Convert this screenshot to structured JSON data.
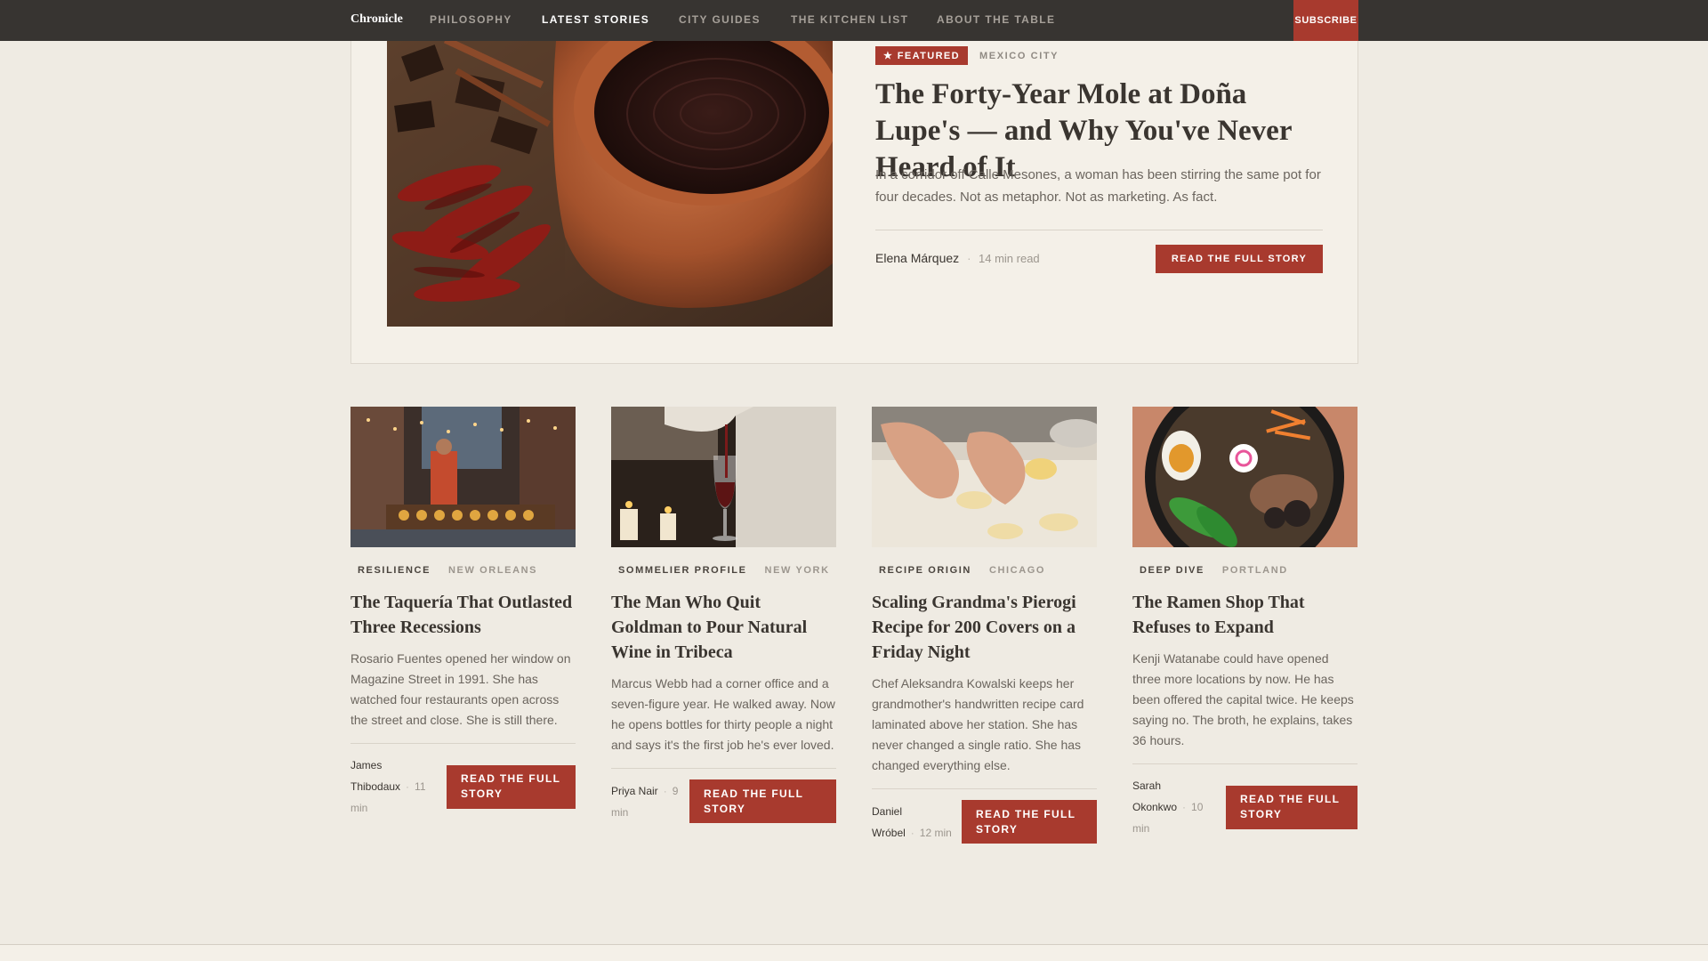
{
  "nav": {
    "brand": "Chronicle",
    "links": [
      "PHILOSOPHY",
      "LATEST STORIES",
      "CITY GUIDES",
      "THE KITCHEN LIST",
      "ABOUT THE TABLE"
    ],
    "active": "LATEST STORIES",
    "subscribe": "SUBSCRIBE"
  },
  "featured": {
    "badge": "★ FEATURED",
    "city": "MEXICO CITY",
    "title": "The Forty-Year Mole at Doña Lupe's — and Why You've Never Heard of It",
    "dek": "In a corridor off Calle Mesones, a woman has been stirring the same pot for four decades. Not as metaphor. Not as marketing. As fact.",
    "author": "Elena Márquez",
    "separator": "·",
    "read_time": "14 min read",
    "cta": "READ THE FULL STORY"
  },
  "cards": [
    {
      "category": "RESILIENCE",
      "city": "NEW ORLEANS",
      "title": "The Taquería That Outlasted Three Recessions",
      "dek": "Rosario Fuentes opened her window on Magazine Street in 1991. She has watched four restaurants open across the street and close. She is still there.",
      "author_first": "James",
      "author_last": "Thibodaux",
      "minutes": "11",
      "unit": "min",
      "cta": "READ THE FULL STORY"
    },
    {
      "category": "SOMMELIER PROFILE",
      "city": "NEW YORK",
      "title": "The Man Who Quit Goldman to Pour Natural Wine in Tribeca",
      "dek": "Marcus Webb had a corner office and a seven-figure year. He walked away. Now he opens bottles for thirty people a night and says it's the first job he's ever loved.",
      "author_first": "Priya Nair",
      "author_last": "",
      "minutes": "9",
      "unit": "min",
      "cta": "READ THE FULL STORY"
    },
    {
      "category": "RECIPE ORIGIN",
      "city": "CHICAGO",
      "title": "Scaling Grandma's Pierogi Recipe for 200 Covers on a Friday Night",
      "dek": "Chef Aleksandra Kowalski keeps her grandmother's handwritten recipe card laminated above her station. She has never changed a single ratio. She has changed everything else.",
      "author_first": "Daniel",
      "author_last": "Wróbel",
      "minutes": "12",
      "unit": "min",
      "cta": "READ THE FULL STORY"
    },
    {
      "category": "DEEP DIVE",
      "city": "PORTLAND",
      "title": "The Ramen Shop That Refuses to Expand",
      "dek": "Kenji Watanabe could have opened three more locations by now. He has been offered the capital twice. He keeps saying no. The broth, he explains, takes 36 hours.",
      "author_first": "Sarah",
      "author_last": "Okonkwo",
      "minutes": "10",
      "unit": "min",
      "cta": "READ THE FULL STORY"
    }
  ],
  "colors": {
    "nav_bg": "#373431",
    "accent": "#a83a2e",
    "page_bg": "#efebe3",
    "card_bg": "#f4f0e8"
  }
}
